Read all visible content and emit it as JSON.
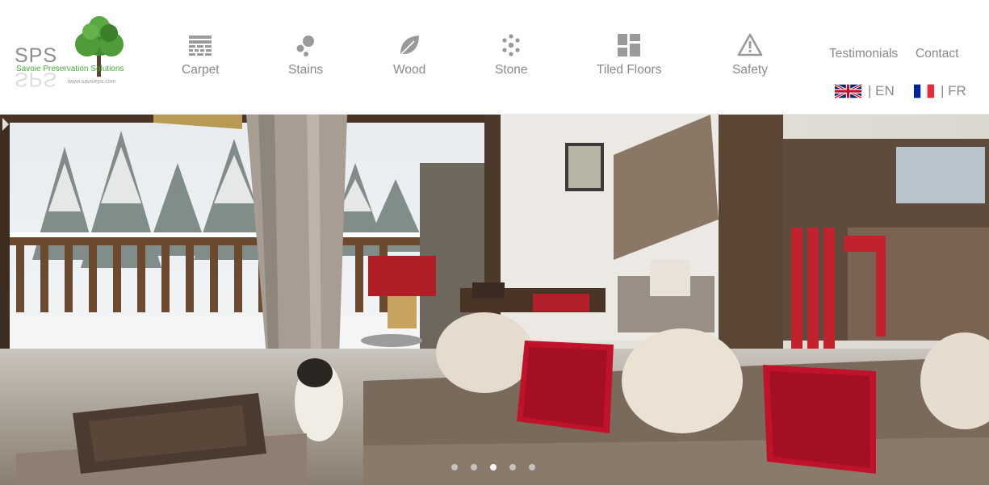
{
  "logo": {
    "abbreviation": "SPS",
    "name": "Savoie Preservation Solutions",
    "url_text": "www.savoieps.com"
  },
  "nav": [
    {
      "label": "Carpet",
      "icon": "carpet-icon"
    },
    {
      "label": "Stains",
      "icon": "stains-icon"
    },
    {
      "label": "Wood",
      "icon": "leaf-icon"
    },
    {
      "label": "Stone",
      "icon": "stone-icon"
    },
    {
      "label": "Tiled Floors",
      "icon": "tiles-icon"
    },
    {
      "label": "Safety",
      "icon": "warning-icon"
    }
  ],
  "top_links": {
    "testimonials": "Testimonials",
    "contact": "Contact"
  },
  "languages": [
    {
      "label": "| EN",
      "flag": "uk-flag-icon"
    },
    {
      "label": "| FR",
      "flag": "france-flag-icon"
    }
  ],
  "slider": {
    "slide_count": 5,
    "active_index": 2
  },
  "colors": {
    "nav_text": "#8a8a8a",
    "logo_green": "#4aa63d",
    "header_bg": "#ffffff"
  }
}
